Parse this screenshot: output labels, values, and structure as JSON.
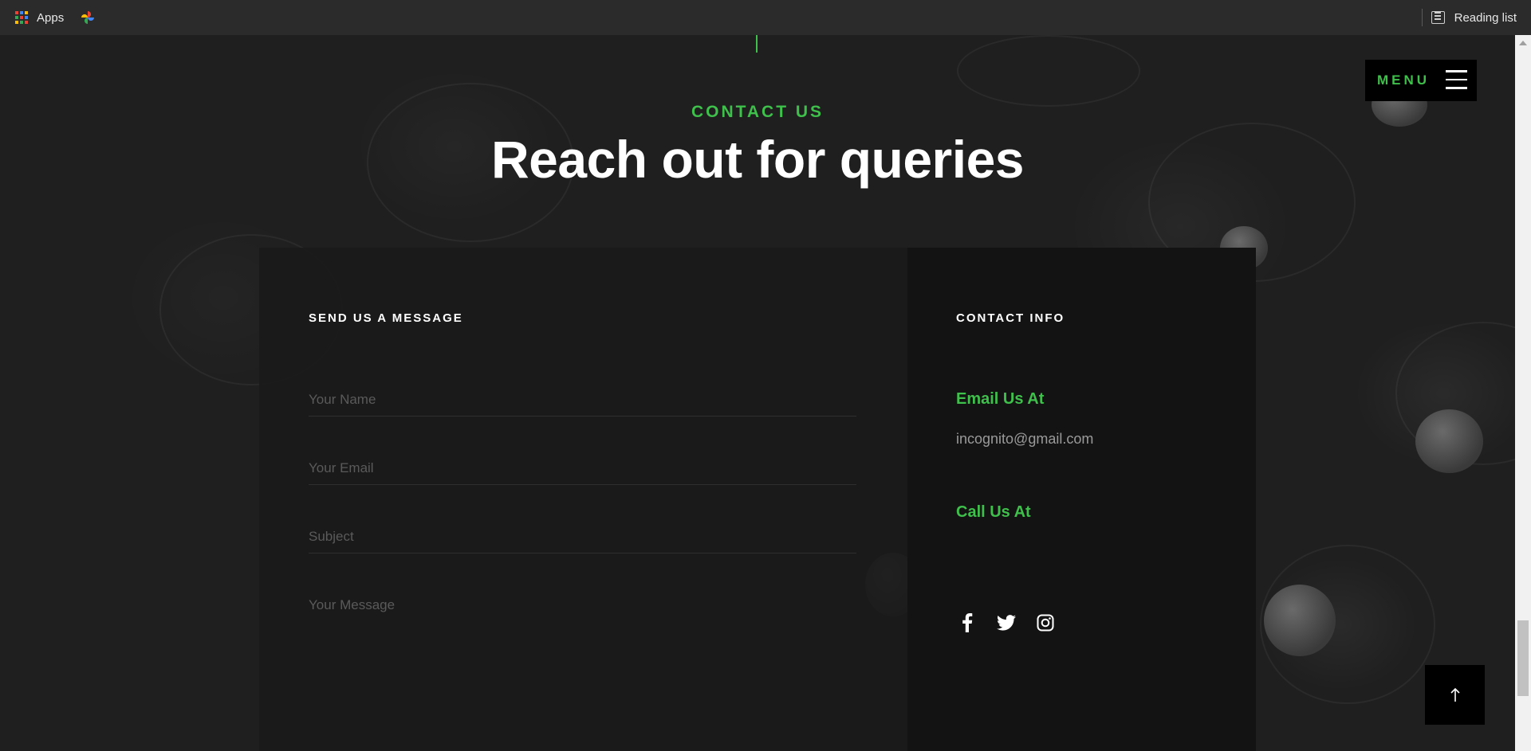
{
  "bookmarks": {
    "apps_label": "Apps",
    "reading_list_label": "Reading list"
  },
  "nav": {
    "menu_label": "MENU"
  },
  "hero": {
    "eyebrow": "CONTACT US",
    "title": "Reach out for queries"
  },
  "form": {
    "title": "SEND US A MESSAGE",
    "name_placeholder": "Your Name",
    "email_placeholder": "Your Email",
    "subject_placeholder": "Subject",
    "message_placeholder": "Your Message"
  },
  "contact_info": {
    "title": "CONTACT INFO",
    "email_heading": "Email Us At",
    "email": "incognito@gmail.com",
    "call_heading": "Call Us At"
  },
  "social": [
    "facebook-icon",
    "twitter-icon",
    "instagram-icon"
  ],
  "colors": {
    "accent": "#3fbf4b",
    "background": "#1f1f1f",
    "card_left": "#1a1a1a",
    "card_right": "#131313"
  }
}
